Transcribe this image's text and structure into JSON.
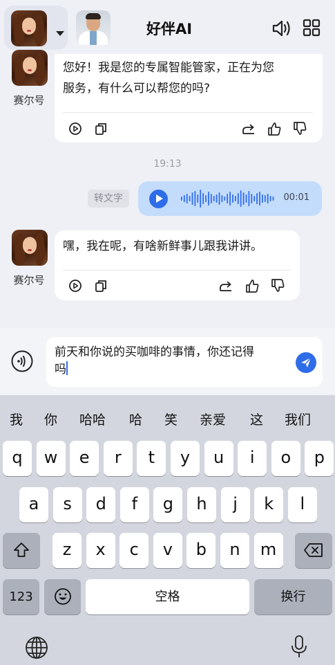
{
  "header": {
    "title": "好伴AI",
    "agent_avatar": "woman-portrait-avatar",
    "doctor_avatar": "doctor-portrait-avatar",
    "speaker_icon": "speaker-icon",
    "grid_icon": "grid-icon"
  },
  "messages": [
    {
      "sender": "赛尔号",
      "line1": "您好！我是您的专属智能管家，正在为您",
      "line2": "服务，有什么可以帮您的吗?"
    },
    {
      "sender": "赛尔号",
      "line1": "嘿，我在呢，有啥新鲜事儿跟我讲讲。"
    }
  ],
  "timestamp": "19:13",
  "voice_message": {
    "to_text_label": "转文字",
    "duration": "00:01"
  },
  "input": {
    "line1": "前天和你说的买咖啡的事情，你还记得",
    "line2": "吗"
  },
  "keyboard": {
    "suggestions": [
      "我",
      "你",
      "哈哈",
      "哈",
      "笑",
      "亲爱",
      "这",
      "我们"
    ],
    "row1": [
      "q",
      "w",
      "e",
      "r",
      "t",
      "y",
      "u",
      "i",
      "o",
      "p"
    ],
    "row2": [
      "a",
      "s",
      "d",
      "f",
      "g",
      "h",
      "j",
      "k",
      "l"
    ],
    "row3": [
      "z",
      "x",
      "c",
      "v",
      "b",
      "n",
      "m"
    ],
    "numbers_key": "123",
    "space_key": "空格",
    "return_key": "换行"
  },
  "colors": {
    "accent": "#2f6de8",
    "voice_bubble": "#c4dcfb",
    "background": "#eef0f5"
  }
}
